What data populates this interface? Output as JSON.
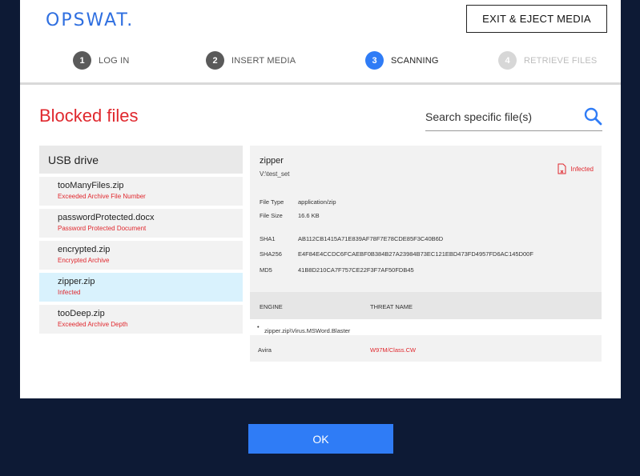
{
  "brand": {
    "logo": "OPSWAT."
  },
  "header": {
    "exit_label": "EXIT & EJECT MEDIA"
  },
  "steps": [
    {
      "num": "1",
      "label": "LOG IN",
      "state": "done"
    },
    {
      "num": "2",
      "label": "INSERT MEDIA",
      "state": "done"
    },
    {
      "num": "3",
      "label": "SCANNING",
      "state": "active"
    },
    {
      "num": "4",
      "label": "RETRIEVE FILES",
      "state": "future"
    }
  ],
  "page": {
    "title": "Blocked files"
  },
  "search": {
    "placeholder": "Search specific file(s)"
  },
  "filelist": {
    "header": "USB drive",
    "items": [
      {
        "name": "tooManyFiles.zip",
        "status": "Exceeded Archive File Number"
      },
      {
        "name": "passwordProtected.docx",
        "status": "Password Protected Document"
      },
      {
        "name": "encrypted.zip",
        "status": "Encrypted Archive"
      },
      {
        "name": "zipper.zip",
        "status": "Infected"
      },
      {
        "name": "tooDeep.zip",
        "status": "Exceeded Archive Depth"
      }
    ],
    "selected_index": 3
  },
  "details": {
    "name": "zipper",
    "path": "V:\\test_set",
    "badge": "Infected",
    "file_type_label": "File Type",
    "file_type": "application/zip",
    "file_size_label": "File Size",
    "file_size": "16.6 KB",
    "sha1_label": "SHA1",
    "sha1": "AB112CB1415A71E839AF78F7E78CDE85F3C40B6D",
    "sha256_label": "SHA256",
    "sha256": "E4F84E4CCDC6FCAEBF0B384B27A23984B73EC121EBD473FD4957FD6AC145D00F",
    "md5_label": "MD5",
    "md5": "41B8D210CA7F757CE22F3F7AF50FDB45",
    "engine_header": "ENGINE",
    "threat_header": "THREAT NAME",
    "threat_path": "zipper.zip\\Virus.MSWord.Blaster",
    "engine": "Avira",
    "threat_name": "W97M/Class.CW"
  },
  "footer": {
    "ok_label": "OK"
  },
  "colors": {
    "accent": "#2f7cf6",
    "danger": "#e0282e",
    "background": "#0d1a35"
  }
}
